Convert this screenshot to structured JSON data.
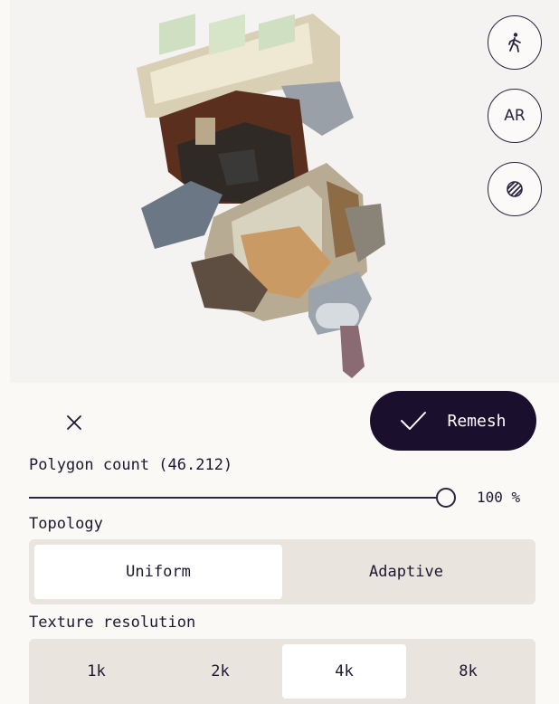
{
  "viewer": {
    "walk_icon": "walking-person-icon",
    "ar_label": "AR",
    "material_icon": "striped-sphere-icon"
  },
  "toolbar": {
    "close_icon": "close-icon",
    "remesh_icon": "check-icon",
    "remesh_label": "Remesh"
  },
  "polygon": {
    "label": "Polygon count (46.212)",
    "slider_percent": 100,
    "value_text": "100 %"
  },
  "topology": {
    "label": "Topology",
    "options": [
      "Uniform",
      "Adaptive"
    ],
    "selected": "Uniform"
  },
  "texture": {
    "label": "Texture resolution",
    "options": [
      "1k",
      "2k",
      "4k",
      "8k"
    ],
    "selected": "4k"
  },
  "colors": {
    "accent": "#1b0f2e",
    "background": "#fbf9f5",
    "segment_bg": "#e9e5de"
  }
}
